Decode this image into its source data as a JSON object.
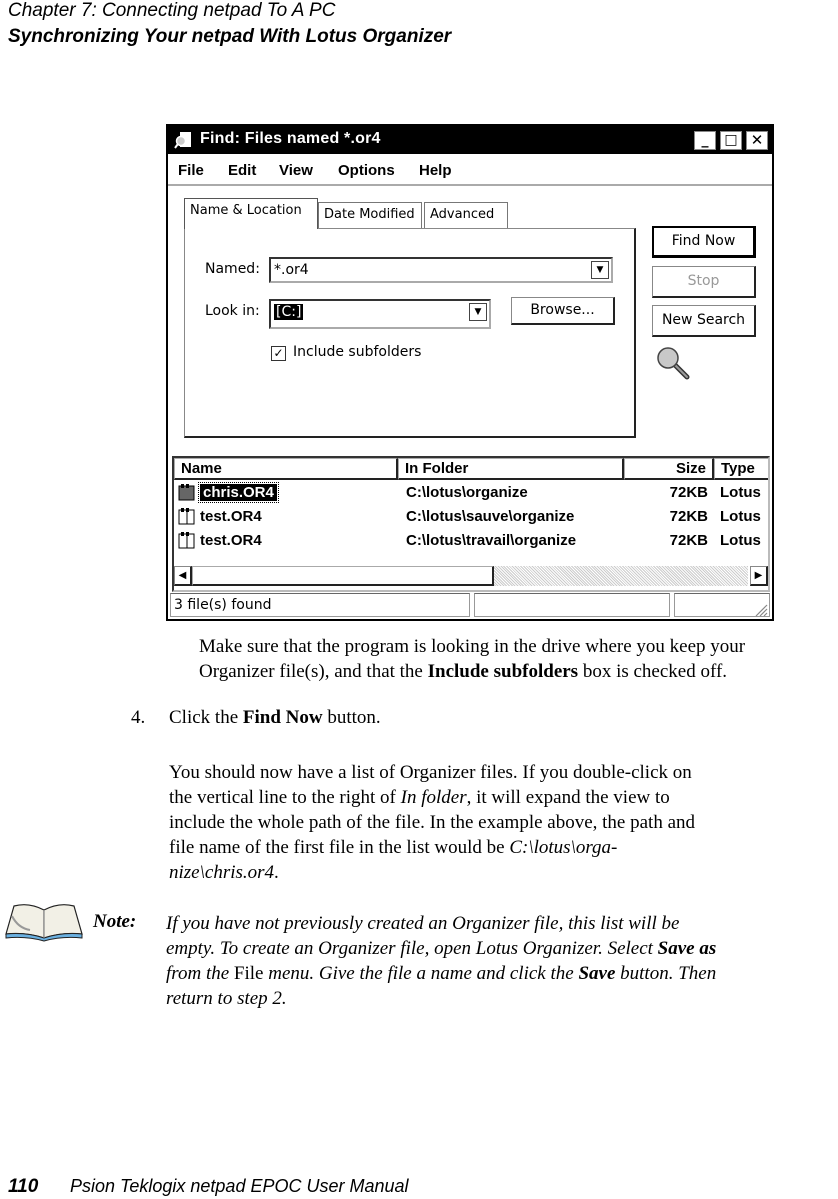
{
  "page_header": {
    "chapter": "Chapter 7:  Connecting netpad To A PC",
    "section": "Synchronizing Your netpad With Lotus Organizer"
  },
  "window": {
    "title": "Find: Files named *.or4",
    "title_icon": "find-magnifier-icon",
    "controls": {
      "minimize": "_",
      "maximize": "□",
      "close": "✕"
    },
    "menu": [
      "File",
      "Edit",
      "View",
      "Options",
      "Help"
    ],
    "tabs": [
      {
        "label": "Name & Location",
        "active": true
      },
      {
        "label": "Date Modified",
        "active": false
      },
      {
        "label": "Advanced",
        "active": false
      }
    ],
    "named_label": "Named:",
    "named_value": "*.or4",
    "look_in_label": "Look in:",
    "look_in_value": "[C:]",
    "browse_label": "Browse...",
    "include_subfolders_label": "Include subfolders",
    "include_subfolders_checked": true,
    "buttons": {
      "find_now": "Find Now",
      "stop": "Stop",
      "new_search": "New Search"
    },
    "results": {
      "columns": [
        "Name",
        "In Folder",
        "Size",
        "Type"
      ],
      "rows": [
        {
          "name": "chris.OR4",
          "folder": "C:\\lotus\\organize",
          "size": "72KB",
          "type": "Lotus",
          "selected": true
        },
        {
          "name": "test.OR4",
          "folder": "C:\\lotus\\sauve\\organize",
          "size": "72KB",
          "type": "Lotus",
          "selected": false
        },
        {
          "name": "test.OR4",
          "folder": "C:\\lotus\\travail\\organize",
          "size": "72KB",
          "type": "Lotus",
          "selected": false
        }
      ]
    },
    "status": "3 file(s) found"
  },
  "body": {
    "para1_a": "Make sure that the program is looking in the drive where you keep your",
    "para1_b1": "Organizer file(s), and that the ",
    "para1_b_bold": "Include subfolders",
    "para1_b2": " box is checked off.",
    "step_num": "4.",
    "step_a": "Click the ",
    "step_bold": "Find Now",
    "step_b": " button.",
    "para2_l1": "You should now have a list of Organizer files. If you double-click on",
    "para2_l2a": "the vertical line to the right of ",
    "para2_l2_it": "In folder",
    "para2_l2b": ", it will expand the view to",
    "para2_l3": "include the whole path of the file. In the example above, the path and",
    "para2_l4a": "file name of the first file in the list would be ",
    "para2_l4_it": "C:\\lotus\\orga-",
    "para2_l5_it": "nize\\chris.or4",
    "para2_l5b": "."
  },
  "note": {
    "label": "Note:",
    "l1": "If you have not previously created an Organizer file, this list will be",
    "l2a": "empty. To create an Organizer file, open Lotus Organizer. Select ",
    "l2_bold": "Save as",
    "l3a": "from the ",
    "l3_roman": "File",
    "l3b": " menu. Give the file a name and click the ",
    "l3_bold": "Save",
    "l3c": " button. Then",
    "l4": "return to step 2."
  },
  "footer": {
    "page_number": "110",
    "manual_title": "Psion Teklogix netpad EPOC User Manual"
  }
}
